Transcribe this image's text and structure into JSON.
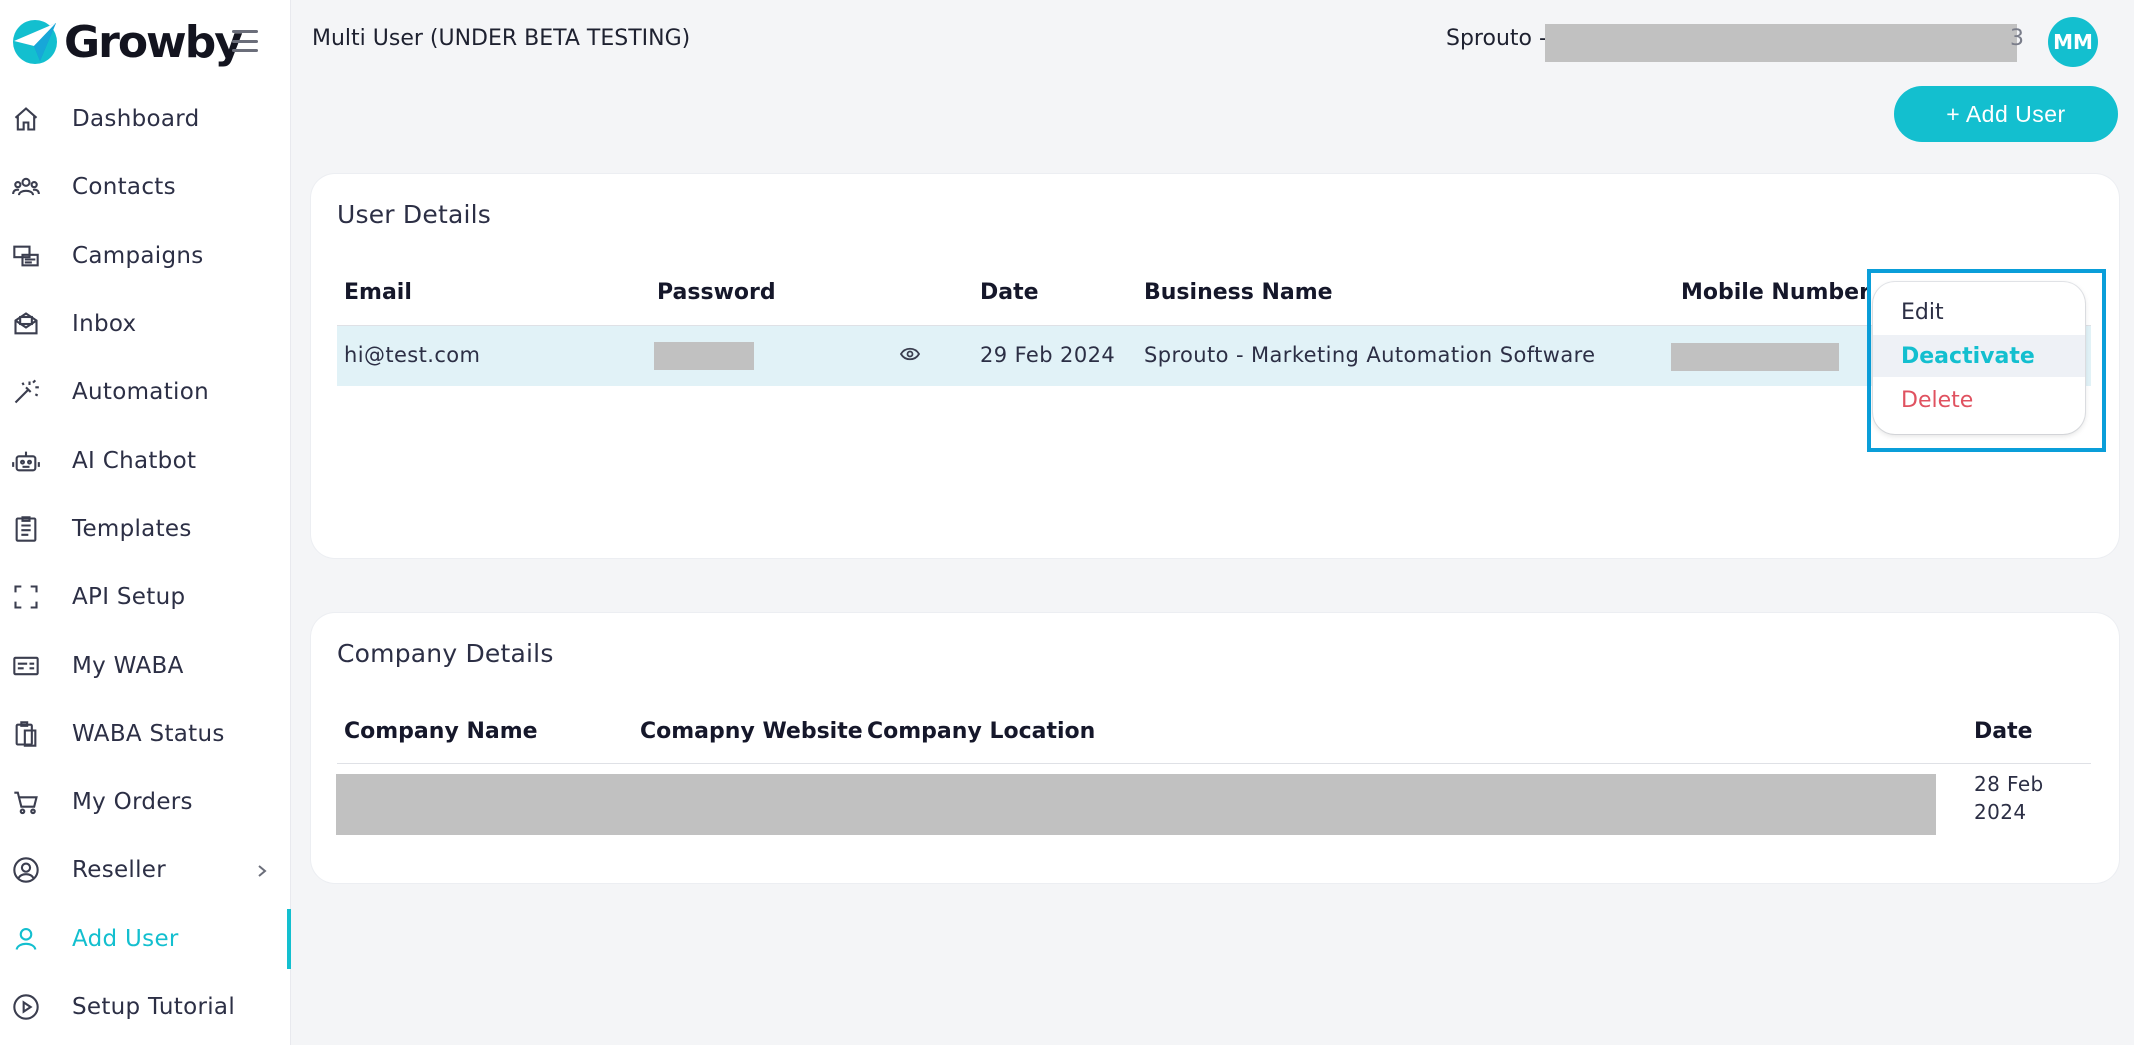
{
  "app": {
    "logo_text": "Growby"
  },
  "sidebar": {
    "items": [
      {
        "label": "Dashboard",
        "icon": "home-icon"
      },
      {
        "label": "Contacts",
        "icon": "users-icon"
      },
      {
        "label": "Campaigns",
        "icon": "campaigns-icon"
      },
      {
        "label": "Inbox",
        "icon": "inbox-icon"
      },
      {
        "label": "Automation",
        "icon": "magic-wand-icon"
      },
      {
        "label": "AI Chatbot",
        "icon": "robot-icon"
      },
      {
        "label": "Templates",
        "icon": "clipboard-icon"
      },
      {
        "label": "API Setup",
        "icon": "frame-icon"
      },
      {
        "label": "My WABA",
        "icon": "id-card-icon"
      },
      {
        "label": "WABA Status",
        "icon": "clipboard-copy-icon"
      },
      {
        "label": "My Orders",
        "icon": "cart-icon"
      },
      {
        "label": "Reseller",
        "icon": "user-circle-icon"
      },
      {
        "label": "Add User",
        "icon": "user-icon",
        "active": true
      },
      {
        "label": "Setup Tutorial",
        "icon": "play-circle-icon"
      }
    ]
  },
  "header": {
    "title": "Multi User (UNDER BETA TESTING)",
    "account_prefix": "Sprouto -",
    "account_suffix": "3",
    "avatar_initials": "MM"
  },
  "actions": {
    "add_user_label": "+ Add User"
  },
  "user_details": {
    "title": "User Details",
    "columns": [
      "Email",
      "Password",
      "Date",
      "Business Name",
      "Mobile Number"
    ],
    "rows": [
      {
        "email": "hi@test.com",
        "date": "29 Feb 2024",
        "business_name": "Sprouto - Marketing Automation Software"
      }
    ]
  },
  "row_menu": {
    "edit": "Edit",
    "deactivate": "Deactivate",
    "delete": "Delete"
  },
  "company_details": {
    "title": "Company Details",
    "columns": [
      "Company Name",
      "Comapny Website",
      "Company Location",
      "Date"
    ],
    "rows": [
      {
        "date_line1": "28 Feb",
        "date_line2": "2024"
      }
    ]
  },
  "colors": {
    "accent": "#13bfcf",
    "delete": "#e05260",
    "highlight_border": "#0a9ed9"
  }
}
